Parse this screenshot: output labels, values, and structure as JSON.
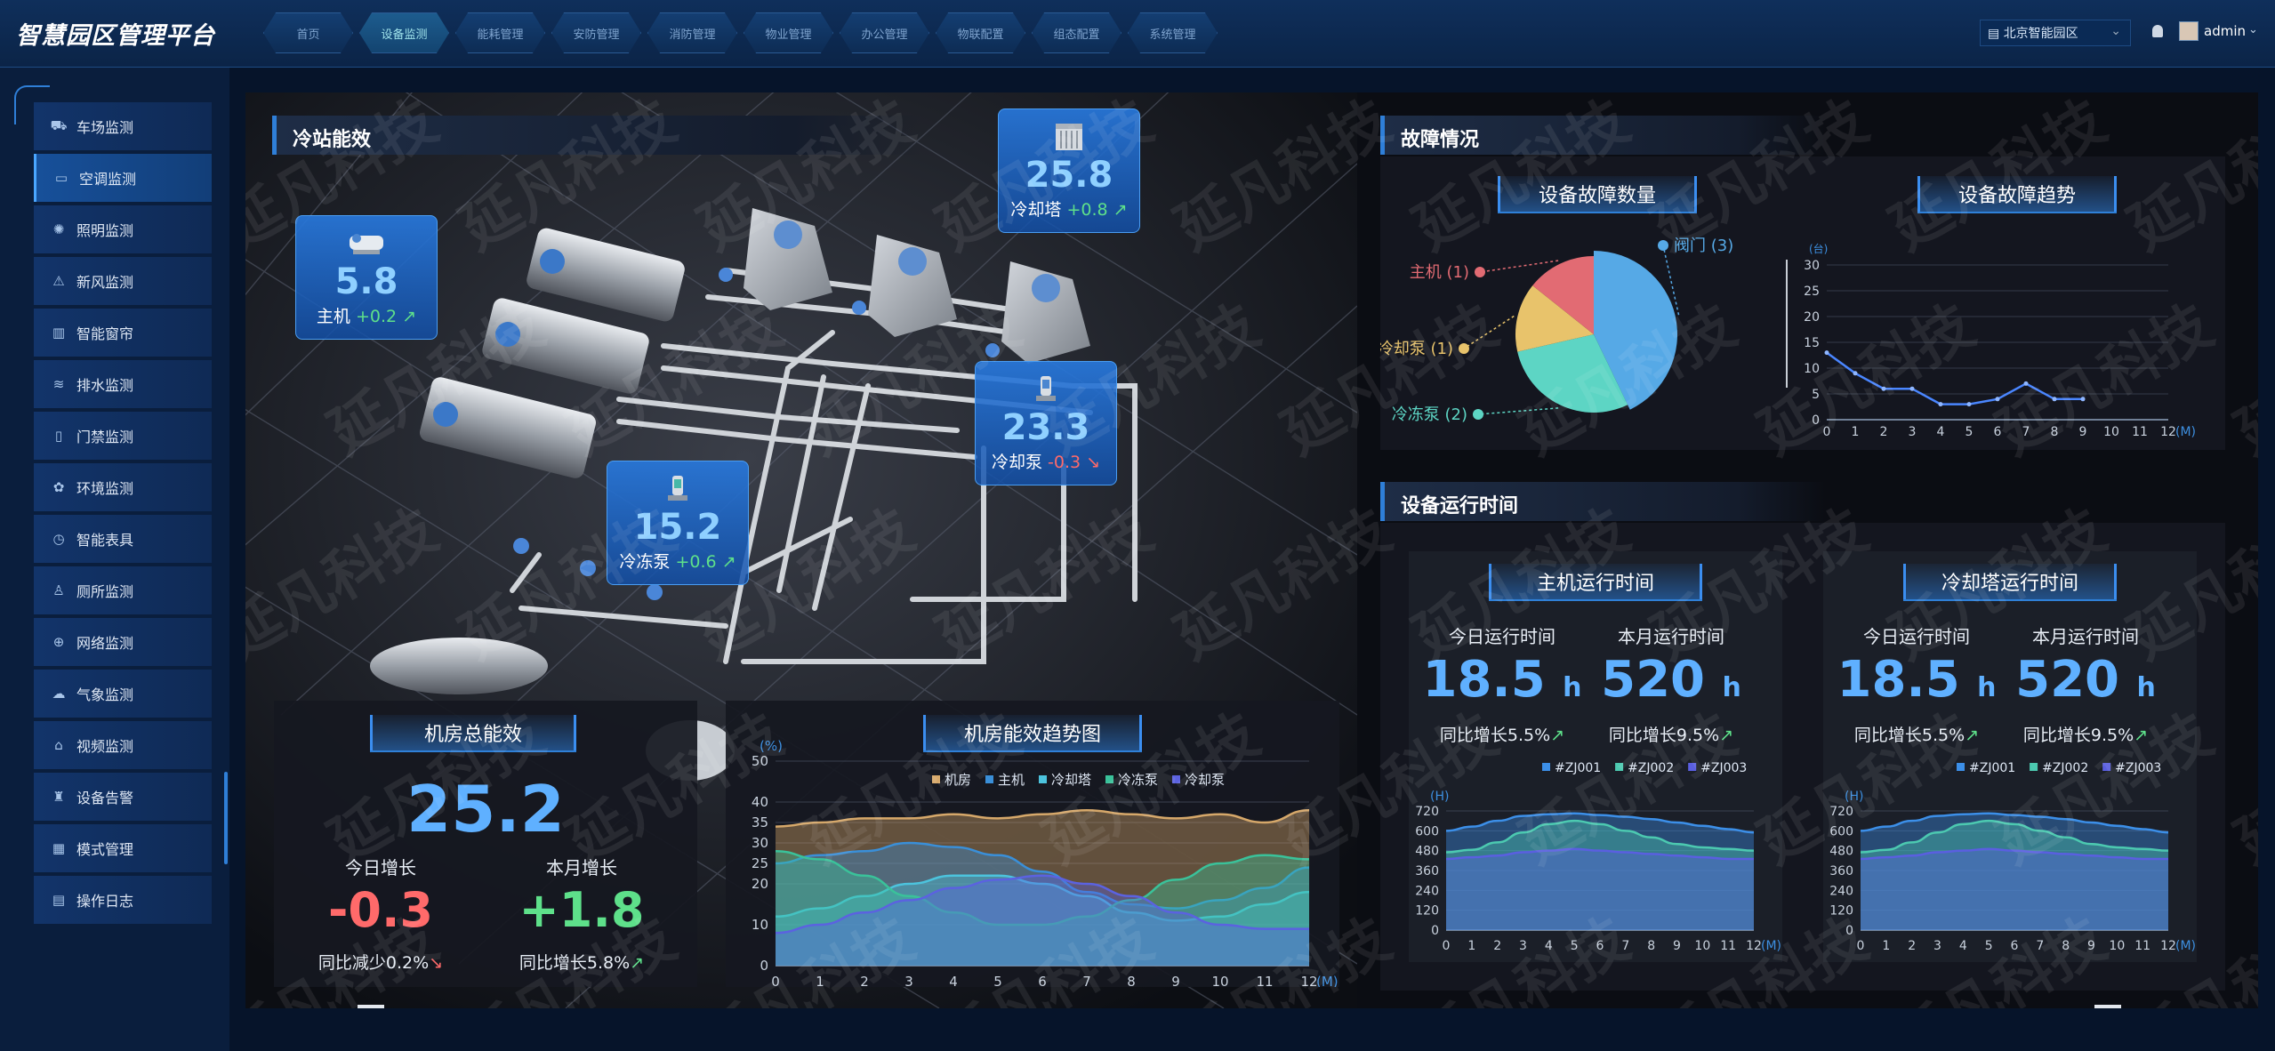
{
  "header": {
    "brand": "智慧园区管理平台",
    "nav": [
      "首页",
      "设备监测",
      "能耗管理",
      "安防管理",
      "消防管理",
      "物业管理",
      "办公管理",
      "物联配置",
      "组态配置",
      "系统管理"
    ],
    "active_nav": 1,
    "region": "北京智能园区",
    "user": "admin"
  },
  "sidebar": {
    "items": [
      {
        "label": "车场监测",
        "icon": "car-icon"
      },
      {
        "label": "空调监测",
        "icon": "air-conditioner-icon"
      },
      {
        "label": "照明监测",
        "icon": "lightbulb-icon"
      },
      {
        "label": "新风监测",
        "icon": "ventilation-icon"
      },
      {
        "label": "智能窗帘",
        "icon": "curtain-icon"
      },
      {
        "label": "排水监测",
        "icon": "drainage-icon"
      },
      {
        "label": "门禁监测",
        "icon": "door-icon"
      },
      {
        "label": "环境监测",
        "icon": "environment-icon"
      },
      {
        "label": "智能表具",
        "icon": "meter-icon"
      },
      {
        "label": "厕所监测",
        "icon": "toilet-icon"
      },
      {
        "label": "网络监测",
        "icon": "globe-icon"
      },
      {
        "label": "气象监测",
        "icon": "weather-icon"
      },
      {
        "label": "视频监测",
        "icon": "camera-icon"
      },
      {
        "label": "设备告警",
        "icon": "alarm-icon"
      },
      {
        "label": "模式管理",
        "icon": "mode-icon"
      },
      {
        "label": "操作日志",
        "icon": "log-icon"
      }
    ],
    "active": 1
  },
  "cold_station": {
    "title": "冷站能效",
    "devices": {
      "host": {
        "value": "5.8",
        "name": "主机",
        "delta": "+0.2"
      },
      "tower": {
        "value": "25.8",
        "name": "冷却塔",
        "delta": "+0.8"
      },
      "cooling_pump": {
        "value": "23.3",
        "name": "冷却泵",
        "delta": "-0.3"
      },
      "chilled_pump": {
        "value": "15.2",
        "name": "冷冻泵",
        "delta": "+0.6"
      }
    },
    "total": {
      "title": "机房总能效",
      "value": "25.2",
      "today_label": "今日增长",
      "today_value": "-0.3",
      "today_note": "同比减少0.2%",
      "month_label": "本月增长",
      "month_value": "+1.8",
      "month_note": "同比增长5.8%"
    }
  },
  "faults": {
    "title": "故障情况",
    "count_title": "设备故障数量",
    "trend_title": "设备故障趋势"
  },
  "runtime": {
    "title": "设备运行时间",
    "host": {
      "title": "主机运行时间",
      "today_label": "今日运行时间",
      "today_value": "18.5",
      "unit": "h",
      "today_note": "同比增长5.5%",
      "month_label": "本月运行时间",
      "month_value": "520",
      "month_note": "同比增长9.5%"
    },
    "tower": {
      "title": "冷却塔运行时间",
      "today_label": "今日运行时间",
      "today_value": "18.5",
      "unit": "h",
      "today_note": "同比增长5.5%",
      "month_label": "本月运行时间",
      "month_value": "520",
      "month_note": "同比增长9.5%"
    }
  },
  "watermark": "延凡科技",
  "colors": {
    "accent": "#2f7fd8",
    "value_blue": "#5fb0ff",
    "up": "#5ee08a",
    "down": "#ff6a6a"
  },
  "chart_data": [
    {
      "id": "fault_count",
      "type": "pie",
      "title": "设备故障数量",
      "slices": [
        {
          "label": "阀门",
          "value": 3,
          "display": "(3)",
          "color": "#56a9e6"
        },
        {
          "label": "冷冻泵",
          "value": 2,
          "display": "(2)",
          "color": "#5dd5c4"
        },
        {
          "label": "冷却泵",
          "value": 1,
          "display": "(1)",
          "color": "#e8c36b"
        },
        {
          "label": "主机",
          "value": 1,
          "display": "(1)",
          "color": "#e26b73"
        }
      ]
    },
    {
      "id": "fault_trend",
      "type": "line",
      "title": "设备故障趋势",
      "ylabel": "(台)",
      "xunit": "(M)",
      "x": [
        0,
        1,
        2,
        3,
        4,
        5,
        6,
        7,
        8,
        9
      ],
      "values": [
        13,
        9,
        6,
        6,
        3,
        3,
        4,
        7,
        4,
        4
      ],
      "xticks": [
        0,
        1,
        2,
        3,
        4,
        5,
        6,
        7,
        8,
        9,
        10,
        11,
        12
      ],
      "yticks": [
        0,
        5,
        10,
        15,
        20,
        25,
        30
      ],
      "ylim": [
        0,
        30
      ],
      "xlim": [
        0,
        12
      ]
    },
    {
      "id": "room_efficiency_trend",
      "type": "area",
      "title": "机房能效趋势图",
      "ylabel": "(%)",
      "xunit": "(M)",
      "x": [
        0,
        1,
        2,
        3,
        4,
        5,
        6,
        7,
        8,
        9,
        10,
        11,
        12
      ],
      "xticks": [
        0,
        1,
        2,
        3,
        4,
        5,
        6,
        7,
        8,
        9,
        10,
        11,
        12
      ],
      "yticks": [
        0,
        10,
        20,
        25,
        30,
        35,
        40,
        50
      ],
      "series": [
        {
          "name": "机房",
          "color": "#d6a86a",
          "values": [
            34,
            35,
            36,
            36,
            37,
            36,
            37,
            38,
            37,
            36,
            37,
            35,
            38
          ]
        },
        {
          "name": "主机",
          "color": "#3a8fd8",
          "values": [
            25,
            27,
            28,
            30,
            29,
            27,
            23,
            18,
            15,
            14,
            16,
            19,
            24
          ]
        },
        {
          "name": "冷却塔",
          "color": "#4cc3dd",
          "values": [
            12,
            14,
            17,
            20,
            22,
            22,
            20,
            17,
            13,
            11,
            12,
            15,
            18
          ]
        },
        {
          "name": "冷冻泵",
          "color": "#3ac29a",
          "values": [
            28,
            26,
            22,
            17,
            13,
            10,
            10,
            12,
            16,
            21,
            25,
            27,
            26
          ]
        },
        {
          "name": "冷却泵",
          "color": "#5b62e0",
          "values": [
            8,
            10,
            13,
            16,
            19,
            21,
            22,
            20,
            17,
            13,
            10,
            9,
            9
          ]
        }
      ]
    },
    {
      "id": "host_runtime",
      "type": "area",
      "ylabel": "(H)",
      "xunit": "(M)",
      "x": [
        0,
        1,
        2,
        3,
        4,
        5,
        6,
        7,
        8,
        9,
        10,
        11,
        12
      ],
      "xticks": [
        0,
        1,
        2,
        3,
        4,
        5,
        6,
        7,
        8,
        9,
        10,
        11,
        12
      ],
      "yticks": [
        0,
        120,
        240,
        360,
        480,
        600,
        720
      ],
      "series": [
        {
          "name": "#ZJ001",
          "color": "#3c8fe8",
          "values": [
            600,
            625,
            660,
            690,
            700,
            705,
            695,
            685,
            670,
            650,
            630,
            610,
            590
          ]
        },
        {
          "name": "#ZJ002",
          "color": "#4cc9b0",
          "values": [
            470,
            485,
            530,
            590,
            640,
            660,
            640,
            600,
            560,
            520,
            500,
            490,
            480
          ]
        },
        {
          "name": "#ZJ003",
          "color": "#5a5fe0",
          "values": [
            430,
            440,
            450,
            470,
            480,
            490,
            480,
            470,
            460,
            450,
            440,
            430,
            430
          ]
        }
      ]
    },
    {
      "id": "tower_runtime",
      "type": "area",
      "ylabel": "(H)",
      "xunit": "(M)",
      "x": [
        0,
        1,
        2,
        3,
        4,
        5,
        6,
        7,
        8,
        9,
        10,
        11,
        12
      ],
      "xticks": [
        0,
        1,
        2,
        3,
        4,
        5,
        6,
        7,
        8,
        9,
        10,
        11,
        12
      ],
      "yticks": [
        0,
        120,
        240,
        360,
        480,
        600,
        720
      ],
      "series": [
        {
          "name": "#ZJ001",
          "color": "#3c8fe8",
          "values": [
            600,
            625,
            660,
            690,
            700,
            705,
            695,
            685,
            670,
            650,
            630,
            610,
            590
          ]
        },
        {
          "name": "#ZJ002",
          "color": "#4cc9b0",
          "values": [
            470,
            485,
            530,
            590,
            640,
            660,
            640,
            600,
            560,
            520,
            500,
            490,
            480
          ]
        },
        {
          "name": "#ZJ003",
          "color": "#5a5fe0",
          "values": [
            430,
            440,
            450,
            470,
            480,
            490,
            480,
            470,
            460,
            450,
            440,
            430,
            430
          ]
        }
      ]
    }
  ]
}
